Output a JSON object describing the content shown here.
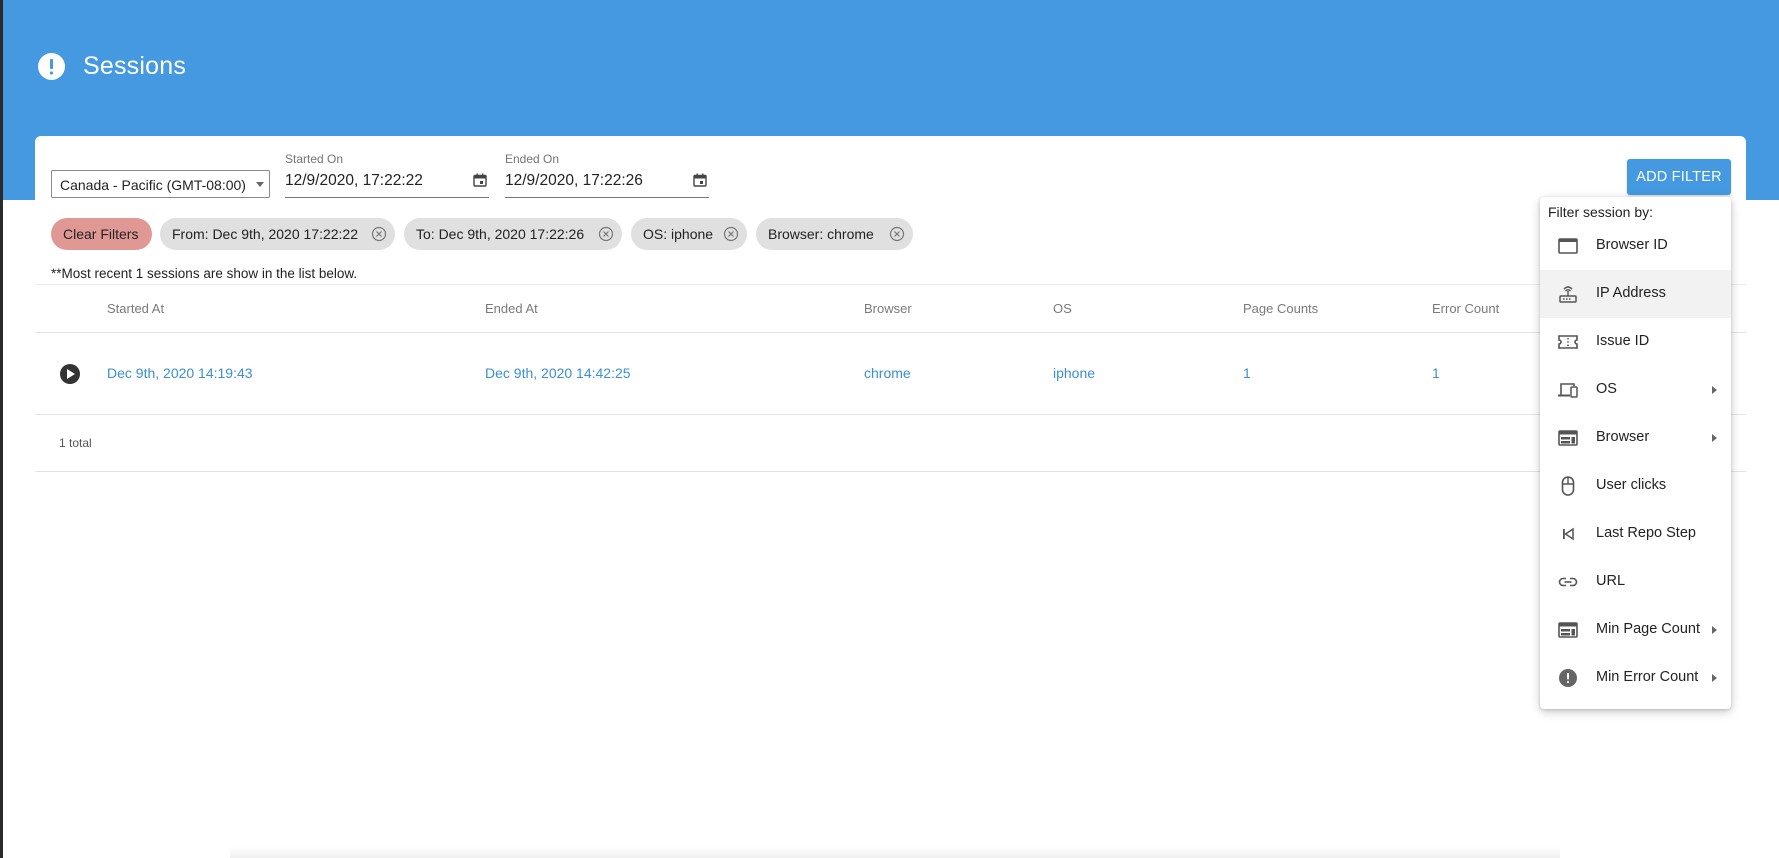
{
  "header": {
    "title": "Sessions",
    "icon": "alert-circle-icon"
  },
  "filters": {
    "timezone": "Canada - Pacific (GMT-08:00)",
    "started_on": {
      "label": "Started On",
      "value": "12/9/2020, 17:22:22"
    },
    "ended_on": {
      "label": "Ended On",
      "value": "12/9/2020, 17:22:26"
    },
    "add_filter_label": "ADD FILTER",
    "clear_label": "Clear Filters",
    "chips": [
      "From: Dec 9th, 2020 17:22:22",
      "To: Dec 9th, 2020 17:22:26",
      "OS: iphone",
      "Browser: chrome"
    ]
  },
  "note": "**Most recent 1 sessions are show in the list below.",
  "table": {
    "columns": [
      "Started At",
      "Ended At",
      "Browser",
      "OS",
      "Page Counts",
      "Error Count"
    ],
    "rows": [
      {
        "started_at": "Dec 9th, 2020 14:19:43",
        "ended_at": "Dec 9th, 2020 14:42:25",
        "browser": "chrome",
        "os": "iphone",
        "page_counts": "1",
        "error_count": "1"
      }
    ],
    "total": "1 total"
  },
  "menu": {
    "title": "Filter session by:",
    "items": [
      {
        "label": "Browser ID",
        "icon": "browser-window-icon",
        "submenu": false
      },
      {
        "label": "IP Address",
        "icon": "router-icon",
        "submenu": false,
        "active": true
      },
      {
        "label": "Issue ID",
        "icon": "ticket-icon",
        "submenu": false
      },
      {
        "label": "OS",
        "icon": "devices-icon",
        "submenu": true
      },
      {
        "label": "Browser",
        "icon": "web-icon",
        "submenu": true
      },
      {
        "label": "User clicks",
        "icon": "mouse-icon",
        "submenu": false
      },
      {
        "label": "Last Repo Step",
        "icon": "skip-previous-icon",
        "submenu": false
      },
      {
        "label": "URL",
        "icon": "link-icon",
        "submenu": false
      },
      {
        "label": "Min Page Count",
        "icon": "web-icon",
        "submenu": true
      },
      {
        "label": "Min Error Count",
        "icon": "error-icon",
        "submenu": true
      }
    ]
  },
  "colors": {
    "header": "#4499e0",
    "link": "#3a8fd6",
    "clear_chip": "#e09895",
    "chip": "#e0e0e0"
  }
}
